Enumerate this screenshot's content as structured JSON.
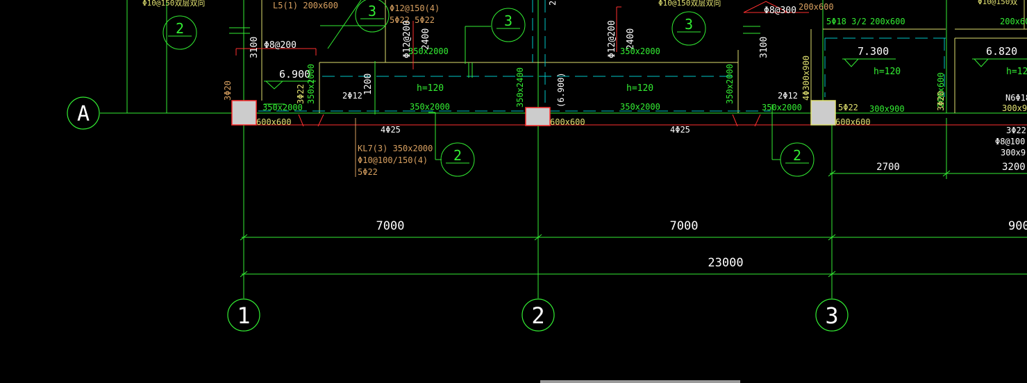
{
  "axes": {
    "row_a": "A",
    "col_1": "1",
    "col_2": "2",
    "col_3": "3"
  },
  "dimensions": {
    "span_1_2": "7000",
    "span_2_3": "7000",
    "overall": "23000",
    "right_partial": "900",
    "sub_right_1": "2700",
    "sub_right_2": "3200"
  },
  "slab": {
    "elev_left": "6.900",
    "elev_mid": "7.300",
    "elev_right": "6.820",
    "h_left": "h=120",
    "h_mid": "h=120",
    "h_right_room": "h=120",
    "h_far_right": "h=12"
  },
  "beam_kl7": {
    "name": "KL7(3) 350x2000",
    "stirrup": "Φ10@100/150(4)",
    "bars": "5Φ22"
  },
  "annotations": {
    "top_left_rebar": "Φ10@150双层双向",
    "top_mid_rebar": "Φ10@150双层双向",
    "l5": "L5(1) 200x600",
    "stirrup_phi12_150": "Φ12@150(4)",
    "bars_5phi22": "5Φ22 5Φ22",
    "phi8_200": "Φ8@200",
    "phi8_300": "Φ8@300",
    "top_right_beam": "200x600",
    "col_dims_left": "3100",
    "col_dims_right": "3100",
    "v_1200": "1200",
    "v_2400_a": "2400",
    "v_2400_b": "2400",
    "phi12_200_a": "Φ12@200",
    "phi12_200_b": "Φ12@200",
    "beam_350x2000_a": "350x2000",
    "beam_350x2000_b": "350x2000",
    "beam_350x2000_c": "350x2000",
    "beam_350x2000_d": "350x2000",
    "beam_350x2000_e": "350x2000",
    "beam_350x2000_f": "350x2000",
    "beam_350x2000_g": "350x2000",
    "beam_350x2000_v1": "350x2000",
    "beam_350x2400_v": "350x2400",
    "beam_6900": "(6.900)",
    "two_phi12_a": "2Φ12",
    "two_phi12_b": "2Φ12",
    "three_phi20": "3Φ20",
    "three_phi22": "3Φ22",
    "four_phi25_a": "4Φ25",
    "four_phi25_b": "4Φ25",
    "col_600x600_a": "600x600",
    "col_600x600_b": "600x600",
    "col_600x600_c": "600x600",
    "five_phi22": "5Φ22",
    "b_300x900": "300x900",
    "b_300x900_v": "4Φ300x900",
    "b_300x900_b": "300x900",
    "phi18": "5Φ18 3/2",
    "beam_200x600_a": "200x600",
    "beam_200x600_b": "200x600",
    "beam_200x600_v": "200x600",
    "three_phi20_b": "3Φ20",
    "n6_phi18": "N6Φ18",
    "phi8_100": "Φ8@100",
    "b_300x90": "300x90",
    "b_300x9_b": "300x9",
    "phi_partial": "Φ10@150双",
    "num_25": "25"
  },
  "section_marks": {
    "s2_a": "2",
    "s2_b": "2",
    "s2_c": "2",
    "s3_a": "3",
    "s3_b": "3",
    "s3_c": "3"
  },
  "colors": {
    "background": "#000000",
    "axis": "#33ee33",
    "beam_red": "#ff3030",
    "wall_yellow": "#e0e070",
    "dash_cyan": "#00c8c8",
    "text_orange": "#d8a060",
    "column_fill": "#cccccc"
  }
}
